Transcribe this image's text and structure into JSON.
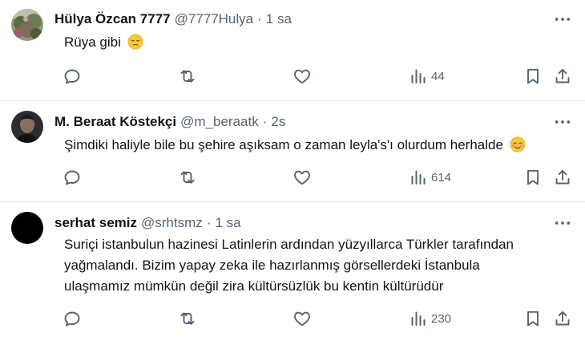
{
  "tweets": [
    {
      "author": "Hülya Özcan 7777",
      "handle": "@7777Hulya",
      "separator": "·",
      "time": "1 sa",
      "text": "Rüya gibi",
      "emoji": "pensive-face",
      "views": "44",
      "avatar": "landscape-photo"
    },
    {
      "author": "M. Beraat Köstekçi",
      "handle": "@m_beraatk",
      "separator": "·",
      "time": "2s",
      "text": "Şimdiki haliyle bile bu şehire aşıksam o zaman leyla's'ı olurdum herhalde",
      "emoji": "smiling-face-with-blush",
      "views": "614",
      "avatar": "portrait-photo"
    },
    {
      "author": "serhat semiz",
      "handle": "@srhtsmz",
      "separator": "·",
      "time": "1 sa",
      "text_lines": [
        "Suriçi istanbulun hazinesi Latinlerin ardından yüzyıllarca Türkler tarafından",
        "yağmalandı. Bizim yapay zeka ile hazırlanmış görsellerdeki İstanbula",
        "ulaşmamız mümkün değil zira kültürsüzlük bu kentin kültürüdür"
      ],
      "views": "230",
      "avatar": "black-circle"
    }
  ],
  "icons": {
    "reply": "reply-icon",
    "retweet": "retweet-icon",
    "like": "heart-icon",
    "views": "views-chart-icon",
    "bookmark": "bookmark-icon",
    "share": "share-icon",
    "more": "more-options-icon"
  },
  "colors": {
    "text_primary": "#0f1419",
    "text_secondary": "#536471",
    "divider": "#e4e9ed",
    "background": "#ffffff"
  }
}
